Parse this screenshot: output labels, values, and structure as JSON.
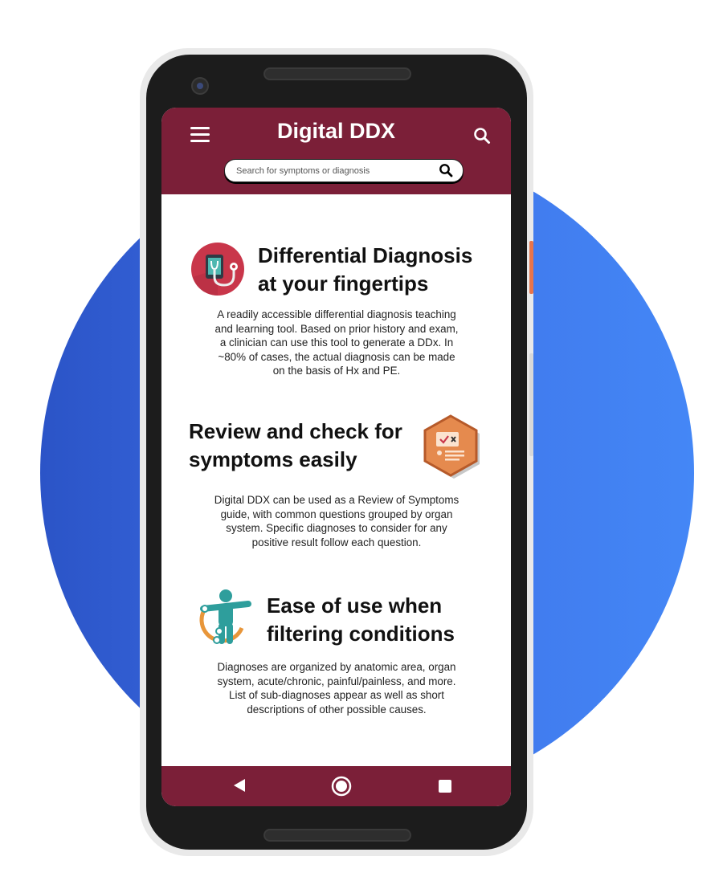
{
  "app": {
    "title": "Digital DDX"
  },
  "search": {
    "placeholder": "Search for symptoms or diagnosis"
  },
  "sections": [
    {
      "heading_line1": "Differential Diagnosis",
      "heading_line2": "at your fingertips",
      "body_lines": [
        "A readily accessible differential diagnosis teaching",
        "and learning tool. Based on prior history and exam,",
        "a clinician can use this tool to generate a DDx. In",
        "~80% of cases, the actual diagnosis can be made",
        "on the basis of Hx and PE."
      ],
      "icon": "stethoscope-tablet-icon"
    },
    {
      "heading_line1": "Review and check for",
      "heading_line2": "symptoms easily",
      "body_lines": [
        "Digital DDX can be used as a Review of Symptoms",
        "guide, with common questions grouped by organ",
        "system. Specific diagnoses to consider for any",
        "positive result follow each question."
      ],
      "icon": "checklist-hexagon-icon"
    },
    {
      "heading_line1": "Ease of use when",
      "heading_line2": "filtering conditions",
      "body_lines": [
        "Diagnoses are organized by anatomic area, organ",
        "system, acute/chronic, painful/painless, and more.",
        "List of sub-diagnoses appear as well as short",
        "descriptions of other possible causes."
      ],
      "icon": "human-body-icon"
    }
  ],
  "colors": {
    "appbar": "#7b1f38",
    "background_circle": "#3d6fe6",
    "icon_red": "#c9364a",
    "icon_orange": "#e58a4e",
    "icon_teal": "#2e9e9c"
  },
  "nav": {
    "icons": [
      "back-icon",
      "home-icon",
      "recents-icon"
    ]
  }
}
